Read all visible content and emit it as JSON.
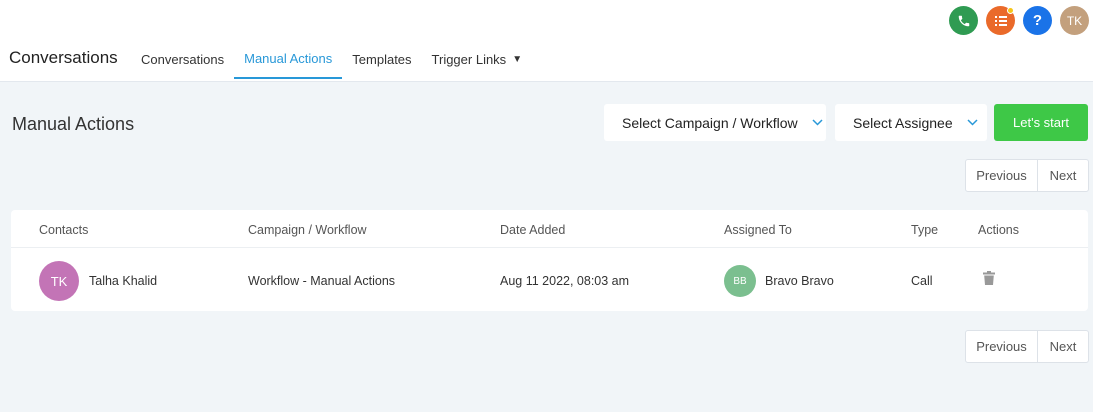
{
  "header": {
    "brand": "Conversations",
    "avatar_initials": "TK",
    "help_glyph": "?",
    "icons": [
      "phone-icon",
      "tasks-icon",
      "help-icon"
    ],
    "colors": {
      "phone": "#2f9b52",
      "tasks": "#ea6a2a",
      "help": "#1a73e8",
      "accent": "#2898d8"
    }
  },
  "nav": {
    "tabs": [
      {
        "label": "Conversations",
        "active": false
      },
      {
        "label": "Manual Actions",
        "active": true
      },
      {
        "label": "Templates",
        "active": false
      },
      {
        "label": "Trigger Links",
        "active": false
      }
    ]
  },
  "page": {
    "title": "Manual Actions",
    "campaign_select": "Select Campaign / Workflow",
    "assignee_select": "Select Assignee",
    "start_button": "Let's start",
    "start_color": "#3ec847"
  },
  "pagination": {
    "previous": "Previous",
    "next": "Next"
  },
  "table": {
    "columns": [
      "Contacts",
      "Campaign / Workflow",
      "Date Added",
      "Assigned To",
      "Type",
      "Actions"
    ],
    "rows": [
      {
        "contact_initials": "TK",
        "contact_name": "Talha Khalid",
        "campaign": "Workflow - Manual Actions",
        "date_added": "Aug 11 2022, 08:03 am",
        "assignee_initials": "BB",
        "assignee_name": "Bravo Bravo",
        "type": "Call",
        "action_icon": "trash-icon"
      }
    ]
  }
}
